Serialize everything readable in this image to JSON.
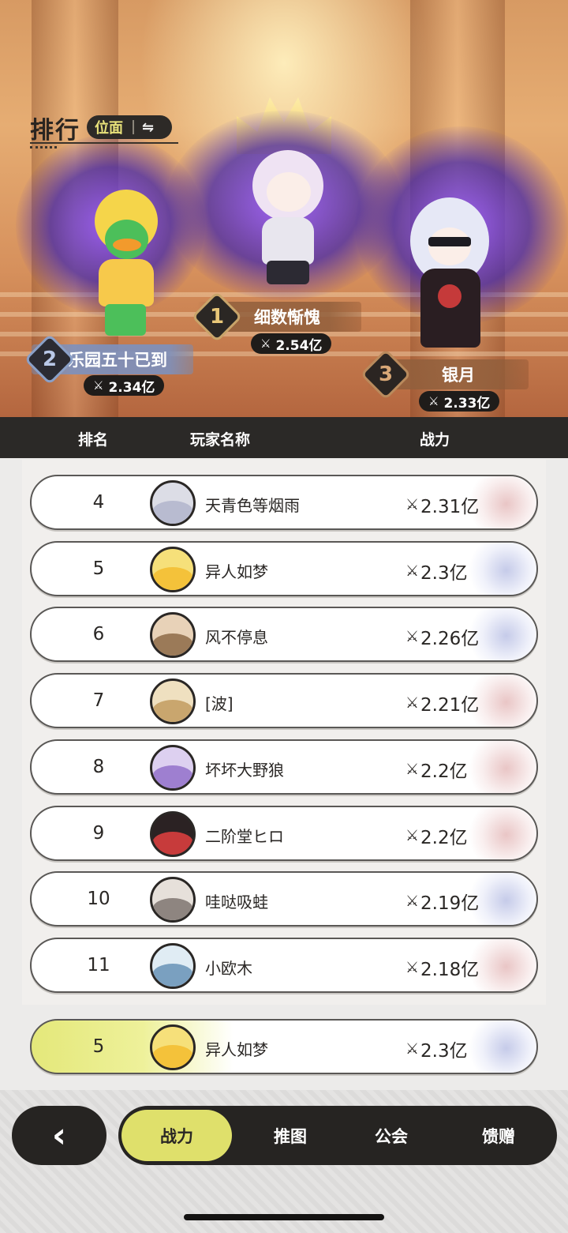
{
  "header": {
    "title": "排行",
    "scope_label": "位面",
    "swap_icon": "⇋"
  },
  "podium": [
    {
      "rank": "1",
      "name": "细数惭愧",
      "power": "2.54亿",
      "badge_color": "#c8a46a"
    },
    {
      "rank": "2",
      "name": "乐园五十已到",
      "power": "2.34亿",
      "badge_color": "#8aa0c8"
    },
    {
      "rank": "3",
      "name": "银月",
      "power": "2.33亿",
      "badge_color": "#b98a5c"
    }
  ],
  "table": {
    "columns": [
      "排名",
      "玩家名称",
      "战力"
    ],
    "rows": [
      {
        "rank": "4",
        "name": "天青色等烟雨",
        "power": "2.31亿",
        "deco": "red"
      },
      {
        "rank": "5",
        "name": "异人如梦",
        "power": "2.3亿",
        "deco": "blue"
      },
      {
        "rank": "6",
        "name": "风不停息",
        "power": "2.26亿",
        "deco": "blue"
      },
      {
        "rank": "7",
        "name": "[波]",
        "power": "2.21亿",
        "deco": "red"
      },
      {
        "rank": "8",
        "name": "坏坏大野狼",
        "power": "2.2亿",
        "deco": "red"
      },
      {
        "rank": "9",
        "name": "二阶堂ヒロ",
        "power": "2.2亿",
        "deco": "red"
      },
      {
        "rank": "10",
        "name": "哇哒吸蛙",
        "power": "2.19亿",
        "deco": "blue"
      },
      {
        "rank": "11",
        "name": "小欧木",
        "power": "2.18亿",
        "deco": "red"
      }
    ]
  },
  "my_rank": {
    "rank": "5",
    "name": "异人如梦",
    "power": "2.3亿"
  },
  "nav": {
    "back_icon": "‹",
    "tabs": [
      {
        "label": "战力",
        "active": true
      },
      {
        "label": "推图",
        "active": false
      },
      {
        "label": "公会",
        "active": false
      },
      {
        "label": "馈赠",
        "active": false
      }
    ]
  },
  "icons": {
    "sword": "⚔"
  }
}
